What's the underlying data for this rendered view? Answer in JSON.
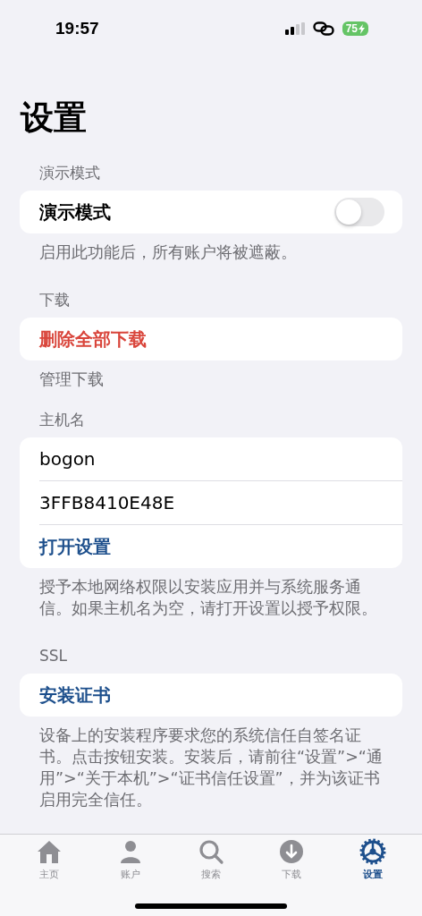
{
  "status_bar": {
    "time": "19:57",
    "battery": "75"
  },
  "title": "设置",
  "sections": [
    {
      "header": "演示模式",
      "rows": [
        {
          "kind": "toggle",
          "label": "演示模式",
          "on": false
        }
      ],
      "footer": "启用此功能后，所有账户将被遮蔽。"
    },
    {
      "header": "下载",
      "rows": [
        {
          "kind": "destructive",
          "label": "删除全部下载"
        }
      ],
      "footer": "管理下载"
    },
    {
      "header": "主机名",
      "rows": [
        {
          "kind": "text",
          "label": "bogon"
        },
        {
          "kind": "text",
          "label": "3FFB8410E48E"
        },
        {
          "kind": "link",
          "label": "打开设置"
        }
      ],
      "footer": "授予本地网络权限以安装应用并与系统服务通信。如果主机名为空，请打开设置以授予权限。"
    },
    {
      "header": "SSL",
      "rows": [
        {
          "kind": "link",
          "label": "安装证书"
        }
      ],
      "footer": "设备上的安装程序要求您的系统信任自签名证书。点击按钮安装。安装后，请前往“设置”>“通用”>“关于本机”>“证书信任设置”，并为该证书启用完全信任。"
    }
  ],
  "tabs": [
    {
      "label": "主页",
      "kind": "home",
      "selected": false
    },
    {
      "label": "账户",
      "kind": "person",
      "selected": false
    },
    {
      "label": "搜索",
      "kind": "search",
      "selected": false
    },
    {
      "label": "下载",
      "kind": "download",
      "selected": false
    },
    {
      "label": "设置",
      "kind": "gear",
      "selected": true
    }
  ]
}
